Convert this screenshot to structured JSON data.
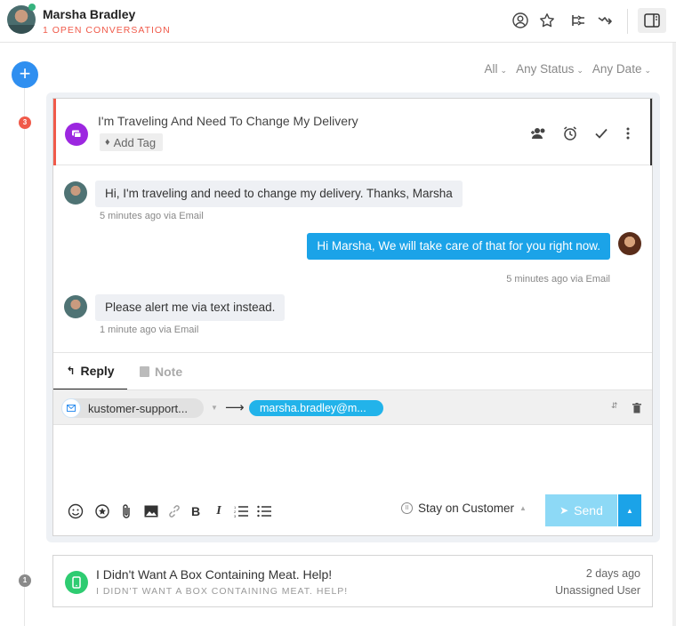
{
  "header": {
    "customer_name": "Marsha Bradley",
    "open_conversations": "1 OPEN CONVERSATION",
    "icons": [
      "user-circle-icon",
      "star-icon",
      "merge-icon",
      "transfer-icon",
      "panel-toggle-icon"
    ]
  },
  "timeline": {
    "add_label": "+",
    "active_count": "3",
    "second_count": "1"
  },
  "filters": {
    "type": "All",
    "status": "Any Status",
    "date": "Any Date"
  },
  "conversation": {
    "title": "I'm Traveling And Need To Change My Delivery",
    "add_tag": "Add Tag",
    "messages": [
      {
        "direction": "in",
        "text": "Hi, I'm traveling and need to change my delivery. Thanks, Marsha",
        "meta": "5 minutes ago via Email"
      },
      {
        "direction": "out",
        "text": "Hi Marsha, We will take care of that for you right now.",
        "meta": "5 minutes ago via Email"
      },
      {
        "direction": "in",
        "text": "Please alert me via text instead.",
        "meta": "1 minute ago via Email"
      }
    ],
    "reply": {
      "tab_reply": "Reply",
      "tab_note": "Note",
      "from": "kustomer-support...",
      "to": "marsha.bradley@m...",
      "stay_label": "Stay on Customer",
      "send_label": "Send"
    }
  },
  "second_conversation": {
    "title": "I Didn't Want A Box Containing Meat. Help!",
    "subtitle": "I DIDN'T WANT A BOX CONTAINING MEAT. HELP!",
    "time": "2 days ago",
    "assignee": "Unassigned User"
  },
  "colors": {
    "accent_blue": "#1ba3e8",
    "alert_red": "#f05a4a",
    "chat_purple": "#9c27e0",
    "sms_green": "#2ecc71"
  }
}
